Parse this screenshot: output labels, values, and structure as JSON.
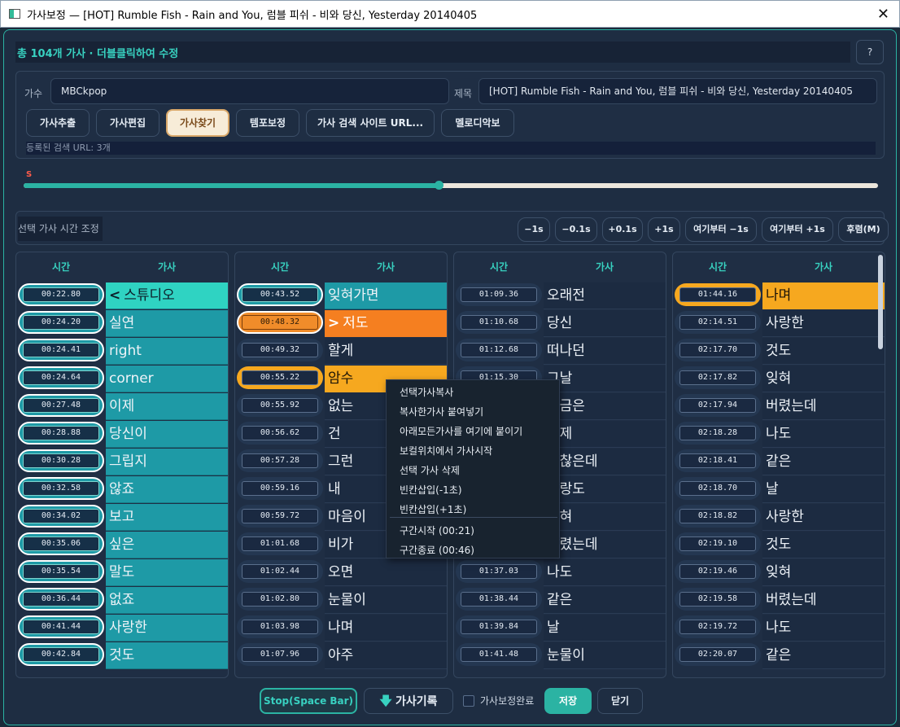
{
  "window": {
    "title": "가사보정 — [HOT] Rumble Fish - Rain and You, 럼블 피쉬 - 비와 당신, Yesterday 20140405",
    "close_glyph": "✕"
  },
  "header": {
    "summary": "총 104개 가사 · 더블클릭하여 수정",
    "help": "?"
  },
  "song": {
    "artist_label": "가수",
    "artist_value": "MBCkpop",
    "title_label": "제목",
    "title_value": "[HOT] Rumble Fish - Rain and You, 럼블 피쉬 - 비와 당신, Yesterday 20140405"
  },
  "toolbar": {
    "extract": "가사추출",
    "edit": "가사편집",
    "find": "가사찾기",
    "tempo": "템포보정",
    "site_url": "가사 검색 사이트 URL...",
    "melody": "멜로디악보"
  },
  "url_status": "등록된 검색 URL: 3개",
  "slider": {
    "marker": "S",
    "progress": 0.486
  },
  "adjust": {
    "label": "선택 가사 시간 조정",
    "minus1": "−1s",
    "minus01": "−0.1s",
    "plus01": "+0.1s",
    "plus1": "+1s",
    "from_minus": "여기부터 −1s",
    "from_plus": "여기부터 +1s",
    "back": "후렴(M)"
  },
  "columns_header": {
    "time": "시간",
    "lyric": "가사"
  },
  "col1": [
    {
      "t": "00:22.80",
      "l": "스튜디오",
      "marker": "<"
    },
    {
      "t": "00:24.20",
      "l": "실연"
    },
    {
      "t": "00:24.41",
      "l": "right"
    },
    {
      "t": "00:24.64",
      "l": "corner"
    },
    {
      "t": "00:27.48",
      "l": "이제"
    },
    {
      "t": "00:28.88",
      "l": "당신이"
    },
    {
      "t": "00:30.28",
      "l": "그립지"
    },
    {
      "t": "00:32.58",
      "l": "않죠"
    },
    {
      "t": "00:34.02",
      "l": "보고"
    },
    {
      "t": "00:35.06",
      "l": "싶은"
    },
    {
      "t": "00:35.54",
      "l": "말도"
    },
    {
      "t": "00:36.44",
      "l": "없죠"
    },
    {
      "t": "00:41.44",
      "l": "사랑한"
    },
    {
      "t": "00:42.84",
      "l": "것도"
    }
  ],
  "col2": [
    {
      "t": "00:43.52",
      "l": "잊혀가면"
    },
    {
      "t": "00:48.32",
      "l": "저도",
      "marker": ">"
    },
    {
      "t": "00:49.32",
      "l": "할게"
    },
    {
      "t": "00:55.22",
      "l": "암수"
    },
    {
      "t": "00:55.92",
      "l": "없는"
    },
    {
      "t": "00:56.62",
      "l": "건"
    },
    {
      "t": "00:57.28",
      "l": "그런"
    },
    {
      "t": "00:59.16",
      "l": "내"
    },
    {
      "t": "00:59.72",
      "l": "마음이"
    },
    {
      "t": "01:01.68",
      "l": "비가"
    },
    {
      "t": "01:02.44",
      "l": "오면"
    },
    {
      "t": "01:02.80",
      "l": "눈물이"
    },
    {
      "t": "01:03.98",
      "l": "나며"
    },
    {
      "t": "01:07.96",
      "l": "아주"
    }
  ],
  "col3": [
    {
      "t": "01:09.36",
      "l": "오래전"
    },
    {
      "t": "01:10.68",
      "l": "당신"
    },
    {
      "t": "01:12.68",
      "l": "떠나던"
    },
    {
      "t": "01:15.30",
      "l": "그날"
    },
    {
      "t": "",
      "l": "지금은"
    },
    {
      "t": "",
      "l": "이제"
    },
    {
      "t": "",
      "l": "괜찮은데"
    },
    {
      "t": "",
      "l": "사랑도"
    },
    {
      "t": "",
      "l": "잊혀"
    },
    {
      "t": "",
      "l": "버렸는데"
    },
    {
      "t": "01:37.03",
      "l": "나도"
    },
    {
      "t": "01:38.44",
      "l": "같은"
    },
    {
      "t": "01:39.84",
      "l": "날"
    },
    {
      "t": "01:41.48",
      "l": "눈물이"
    }
  ],
  "col4": [
    {
      "t": "01:44.16",
      "l": "나며"
    },
    {
      "t": "02:14.51",
      "l": "사랑한"
    },
    {
      "t": "02:17.70",
      "l": "것도"
    },
    {
      "t": "02:17.82",
      "l": "잊혀"
    },
    {
      "t": "02:17.94",
      "l": "버렸는데"
    },
    {
      "t": "02:18.28",
      "l": "나도"
    },
    {
      "t": "02:18.41",
      "l": "같은"
    },
    {
      "t": "02:18.70",
      "l": "날"
    },
    {
      "t": "02:18.82",
      "l": "사랑한"
    },
    {
      "t": "02:19.10",
      "l": "것도"
    },
    {
      "t": "02:19.46",
      "l": "잊혀"
    },
    {
      "t": "02:19.58",
      "l": "버렸는데"
    },
    {
      "t": "02:19.72",
      "l": "나도"
    },
    {
      "t": "02:20.07",
      "l": "같은"
    }
  ],
  "context_menu": {
    "copy": "선택가사복사",
    "paste": "복사한가사 붙여넣기",
    "paste_all_below": "아래모든가사를 여기에 붙이기",
    "start_vocal": "보컬위치에서 가사시작",
    "delete": "선택 가사 삭제",
    "insert_minus": "빈칸삽입(-1초)",
    "insert_plus": "빈칸삽입(+1초)",
    "section_start": "구간시작 (00:21)",
    "section_end": "구간종료 (00:46)"
  },
  "bottom": {
    "stop": "Stop(Space Bar)",
    "record": "가사기록",
    "done_label": "가사보정완료",
    "save": "저장",
    "close": "닫기"
  }
}
